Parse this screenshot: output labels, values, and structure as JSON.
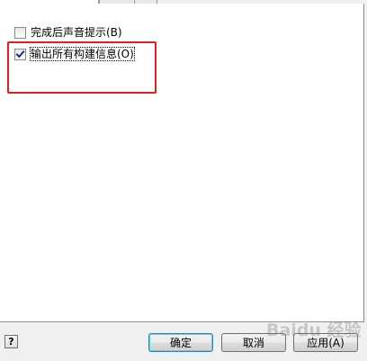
{
  "options": [
    {
      "label": "完成后声音提示(B)",
      "checked": false
    },
    {
      "label": "输出所有构建信息(O)",
      "checked": true
    }
  ],
  "buttons": {
    "help": "?",
    "ok": "确定",
    "cancel": "取消",
    "apply": "应用(A)"
  },
  "watermark": "Baidu 经验",
  "colors": {
    "highlight": "#e81e1e",
    "panel": "#ffffff",
    "window": "#f0f0f0"
  }
}
